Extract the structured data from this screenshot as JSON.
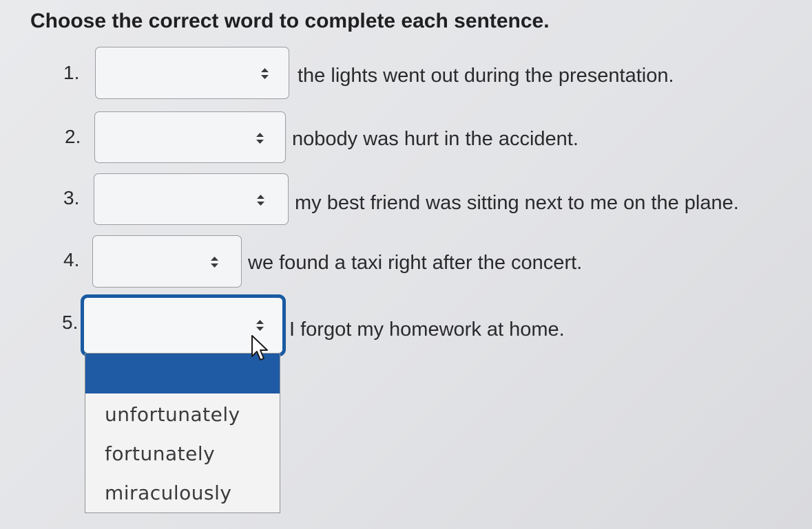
{
  "instruction": "Choose the correct word to complete each sentence.",
  "questions": [
    {
      "number": "1.",
      "selected": "",
      "text": "the lights went out during the presentation."
    },
    {
      "number": "2.",
      "selected": "",
      "text": "nobody was hurt in the accident."
    },
    {
      "number": "3.",
      "selected": "",
      "text": "my best friend was sitting next to me on the plane."
    },
    {
      "number": "4.",
      "selected": "",
      "text": "we found a taxi right after the concert."
    },
    {
      "number": "5.",
      "selected": "",
      "text": "I forgot my homework at home."
    }
  ],
  "dropdown": {
    "options": [
      "unfortunately",
      "fortunately",
      "miraculously"
    ],
    "highlight_color": "#1f5aa4"
  },
  "icons": {
    "select_arrow": "updown-arrows-icon",
    "cursor": "mouse-pointer-icon"
  }
}
